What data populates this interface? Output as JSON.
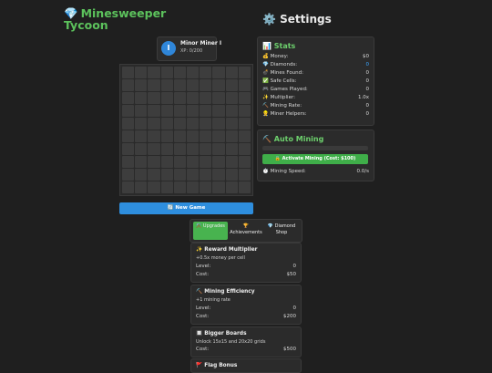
{
  "game": {
    "title": "Minesweeper Tycoon",
    "title_icon": "💎",
    "settings_title": "Settings",
    "settings_icon": "⚙️"
  },
  "player": {
    "avatar_letter": "I",
    "name": "Minor Miner I",
    "xp": "XP: 0/200"
  },
  "board": {
    "rows": 10,
    "cols": 10
  },
  "new_game_label": "🔄 New Game",
  "stats": {
    "title": "📊 Stats",
    "rows": [
      {
        "label": "💰 Money:",
        "value": "$0"
      },
      {
        "label": "💎 Diamonds:",
        "value": "0"
      },
      {
        "label": "💣 Mines Found:",
        "value": "0"
      },
      {
        "label": "✅ Safe Cells:",
        "value": "0"
      },
      {
        "label": "🎮 Games Played:",
        "value": "0"
      },
      {
        "label": "✨ Multiplier:",
        "value": "1.0x"
      },
      {
        "label": "⛏️ Mining Rate:",
        "value": "0"
      },
      {
        "label": "👷 Miner Helpers:",
        "value": "0"
      }
    ]
  },
  "auto_mining": {
    "title": "⛏️ Auto Mining",
    "progress": 0,
    "button_label": "🔒 Activate Mining (Cost: $100)",
    "speed_label": "⏱️ Mining Speed:",
    "speed_value": "0.0/s"
  },
  "tabs": [
    {
      "label": "⚒️ Upgrades",
      "active": true
    },
    {
      "label": "🏆 Achievements",
      "active": false
    },
    {
      "label": "💎 Diamond Shop",
      "active": false
    }
  ],
  "upgrades": [
    {
      "title": "✨ Reward Multiplier",
      "desc": "+0.5x money per cell",
      "level_label": "Level:",
      "level": "0",
      "cost_label": "Cost:",
      "cost": "$50"
    },
    {
      "title": "⛏️ Mining Efficiency",
      "desc": "+1 mining rate",
      "level_label": "Level:",
      "level": "0",
      "cost_label": "Cost:",
      "cost": "$200"
    },
    {
      "title": "🔲 Bigger Boards",
      "desc": "Unlock 15x15 and 20x20 grids",
      "cost_label": "Cost:",
      "cost": "$500"
    },
    {
      "title": "🚩 Flag Bonus"
    }
  ],
  "colors": {
    "accent_green": "#48b34f",
    "title_green": "#5cc25c",
    "button_blue": "#2e8ede",
    "diamond_blue": "#3aa5ff"
  }
}
